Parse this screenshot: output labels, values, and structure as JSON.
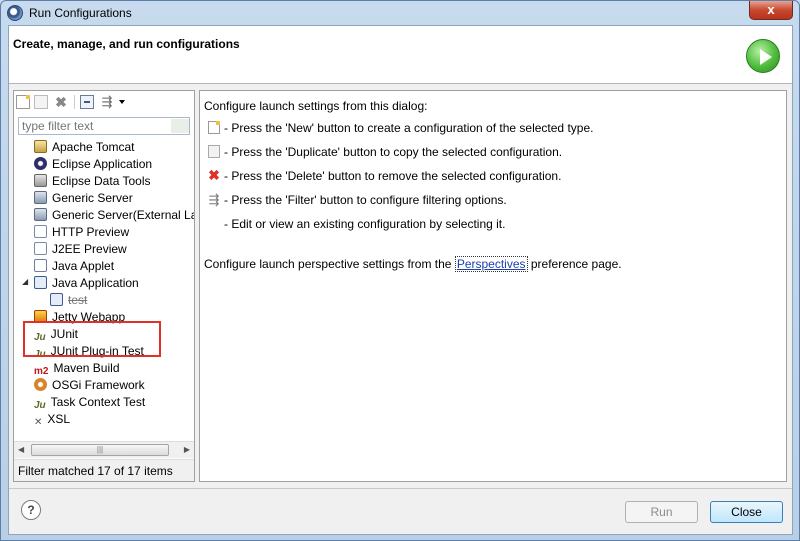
{
  "window": {
    "title": "Run Configurations",
    "close_label": "x"
  },
  "banner": {
    "title": "Create, manage, and run configurations"
  },
  "left": {
    "filter_placeholder": "type filter text",
    "items": [
      {
        "label": "Apache Tomcat",
        "icon": "tomcat-icon"
      },
      {
        "label": "Eclipse Application",
        "icon": "eclipse-icon"
      },
      {
        "label": "Eclipse Data Tools",
        "icon": "database-icon"
      },
      {
        "label": "Generic Server",
        "icon": "server-icon"
      },
      {
        "label": "Generic Server(External Lau",
        "icon": "server-icon"
      },
      {
        "label": "HTTP Preview",
        "icon": "http-preview-icon"
      },
      {
        "label": "J2EE Preview",
        "icon": "j2ee-preview-icon"
      },
      {
        "label": "Java Applet",
        "icon": "java-applet-icon"
      },
      {
        "label": "Java Application",
        "icon": "java-application-icon"
      },
      {
        "label": "test",
        "icon": "java-test-icon"
      },
      {
        "label": "Jetty Webapp",
        "icon": "jetty-icon"
      },
      {
        "label": "JUnit",
        "icon": "junit-icon"
      },
      {
        "label": "JUnit Plug-in Test",
        "icon": "junit-plugin-icon"
      },
      {
        "label": "Maven Build",
        "icon": "maven-icon"
      },
      {
        "label": "OSGi Framework",
        "icon": "osgi-icon"
      },
      {
        "label": "Task Context Test",
        "icon": "task-context-icon"
      },
      {
        "label": "XSL",
        "icon": "xsl-icon"
      }
    ],
    "status": "Filter matched 17 of 17 items"
  },
  "right": {
    "intro": "Configure launch settings from this dialog:",
    "lines": [
      "- Press the 'New' button to create a configuration of the selected type.",
      "- Press the 'Duplicate' button to copy the selected configuration.",
      "- Press the 'Delete' button to remove the selected configuration.",
      "- Press the 'Filter' button to configure filtering options.",
      "- Edit or view an existing configuration by selecting it."
    ],
    "perspective_prefix": "Configure launch perspective settings from the ",
    "perspective_link": "Perspectives",
    "perspective_suffix": " preference page."
  },
  "buttons": {
    "help": "?",
    "run": "Run",
    "close": "Close"
  }
}
